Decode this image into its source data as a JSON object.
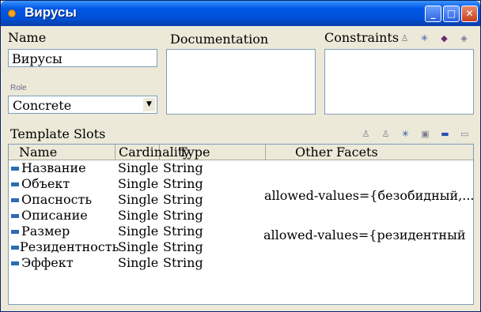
{
  "window": {
    "title": "Вирусы",
    "controls": [
      "minimize",
      "maximize",
      "close"
    ]
  },
  "name": {
    "label": "Name",
    "value": "Вирусы"
  },
  "role": {
    "label": "Role",
    "value": "Concrete"
  },
  "documentation": {
    "label": "Documentation"
  },
  "constraints": {
    "label": "Constraints",
    "icons": [
      "view-constraint-icon",
      "create-constraint-icon",
      "add-constraint-icon",
      "remove-constraint-icon"
    ]
  },
  "template_slots": {
    "label": "Template Slots",
    "icons": [
      "view-slot-icon",
      "view-facet-icon",
      "create-slot-icon",
      "add-slot-icon",
      "move-slot-icon",
      "remove-slot-icon"
    ],
    "columns": [
      "Name",
      "Cardinality",
      "Type",
      "Other Facets"
    ],
    "rows": [
      {
        "name": "Название",
        "cardinality": "Single",
        "type": "String",
        "other": ""
      },
      {
        "name": "Объект",
        "cardinality": "Single",
        "type": "String",
        "other": ""
      },
      {
        "name": "Опасность",
        "cardinality": "Single",
        "type": "String",
        "other": "allowed-values={безобидный,..."
      },
      {
        "name": "Описание",
        "cardinality": "Single",
        "type": "String",
        "other": ""
      },
      {
        "name": "Размер",
        "cardinality": "Single",
        "type": "String",
        "other": "allowed-values={резидентный"
      },
      {
        "name": "Резидентность",
        "cardinality": "Single",
        "type": "String",
        "other": ""
      },
      {
        "name": "Эффект",
        "cardinality": "Single",
        "type": "String",
        "other": ""
      }
    ]
  },
  "colors": {
    "titlebar": "#0058e6",
    "slot_icon": "#2d6bb5",
    "window_bg": "#ece9d8"
  }
}
